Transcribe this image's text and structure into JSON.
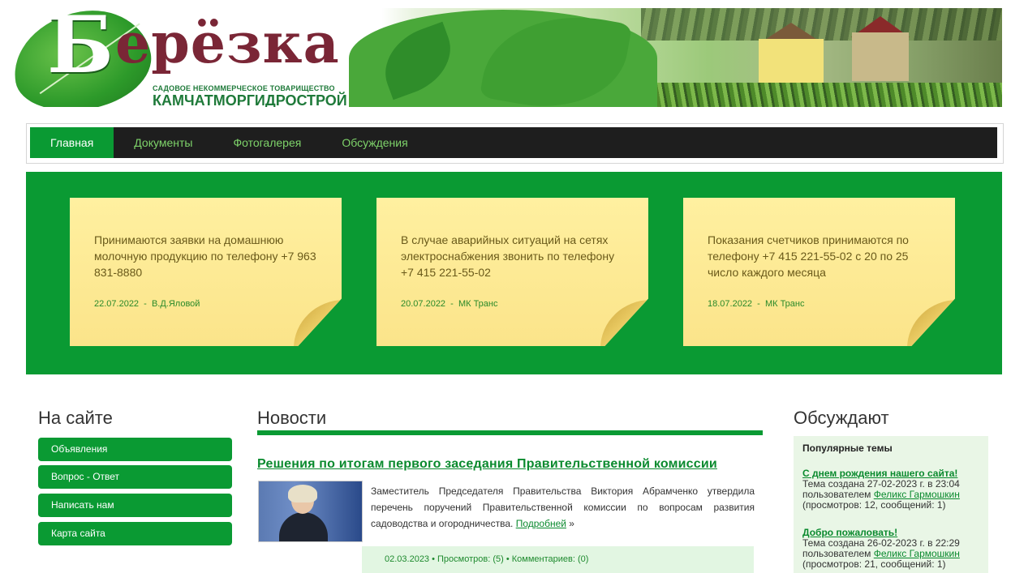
{
  "header": {
    "logo_first_letter": "Б",
    "logo_rest": "ерёзка",
    "subtitle_line1": "САДОВОЕ НЕКОММЕРЧЕСКОЕ ТОВАРИЩЕСТВО",
    "subtitle_line2": "КАМЧАТМОРГИДРОСТРОЙ"
  },
  "nav": {
    "items": [
      "Главная",
      "Документы",
      "Фотогалерея",
      "Обсуждения"
    ],
    "active_index": 0
  },
  "notes": [
    {
      "text": "Принимаются заявки на домашнюю молочную продукцию по телефону +7 963 831-8880",
      "date": "22.07.2022",
      "author": "В.Д.Яловой"
    },
    {
      "text": "В случае аварийных ситуаций на сетях электроснабжения звонить по телефону +7 415 221-55-02",
      "date": "20.07.2022",
      "author": "МК Транс"
    },
    {
      "text": "Показания счетчиков принимаются по телефону +7 415 221-55-02 с 20 по 25 число каждого месяца",
      "date": "18.07.2022",
      "author": "МК Транс"
    }
  ],
  "sidebar": {
    "title": "На сайте",
    "items": [
      "Объявления",
      "Вопрос - Ответ",
      "Написать нам",
      "Карта сайта"
    ]
  },
  "news": {
    "title": "Новости",
    "article": {
      "title": "Решения по итогам первого заседания Правительственной комиссии",
      "text": "Заместитель Председателя Правительства Виктория Абрамченко утвердила перечень поручений Правительственной комиссии по вопросам развития садоводства и огородничества.",
      "more_label": "Подробней",
      "more_suffix": "»",
      "meta": "02.03.2023 • Просмотров: (5) • Комментариев: (0)"
    }
  },
  "discuss": {
    "title": "Обсуждают",
    "popular_label": "Популярные темы",
    "topics": [
      {
        "title": "С днем рождения нашего сайта!",
        "created": "Тема создана 27-02-2023 г. в 23:04",
        "by_label": "пользователем",
        "user": "Феликс Гармошкин",
        "stats": "(просмотров: 12, сообщений: 1)"
      },
      {
        "title": "Добро пожаловать!",
        "created": "Тема создана 26-02-2023 г. в 22:29",
        "by_label": "пользователем",
        "user": "Феликс Гармошкин",
        "stats": "(просмотров: 21, сообщений: 1)"
      }
    ]
  },
  "colors": {
    "brand_green": "#0a9a33",
    "nav_bg": "#1e1e1e",
    "note_yellow": "#fbe48a",
    "logo_burgundy": "#7a2636"
  }
}
